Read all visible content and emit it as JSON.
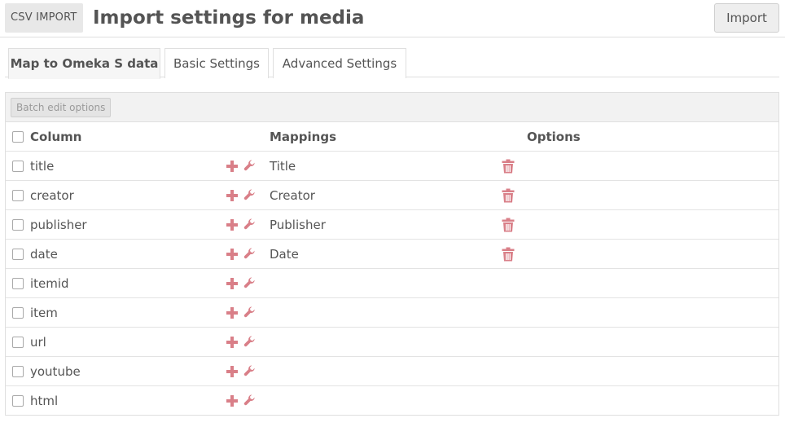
{
  "header": {
    "module_label": "CSV IMPORT",
    "title": "Import settings for media",
    "import_label": "Import"
  },
  "tabs": [
    {
      "label": "Map to Omeka S data",
      "active": true
    },
    {
      "label": "Basic Settings",
      "active": false
    },
    {
      "label": "Advanced Settings",
      "active": false
    }
  ],
  "batch": {
    "label": "Batch edit options"
  },
  "table": {
    "headers": {
      "column": "Column",
      "mappings": "Mappings",
      "options": "Options"
    },
    "rows": [
      {
        "column": "title",
        "mapping": "Title"
      },
      {
        "column": "creator",
        "mapping": "Creator"
      },
      {
        "column": "publisher",
        "mapping": "Publisher"
      },
      {
        "column": "date",
        "mapping": "Date"
      },
      {
        "column": "itemid",
        "mapping": ""
      },
      {
        "column": "item",
        "mapping": ""
      },
      {
        "column": "url",
        "mapping": ""
      },
      {
        "column": "youtube",
        "mapping": ""
      },
      {
        "column": "html",
        "mapping": ""
      }
    ]
  },
  "icons": {
    "add": "plus-icon",
    "configure": "wrench-icon",
    "remove": "trash-icon"
  },
  "colors": {
    "accent": "#d97f88",
    "border": "#dfdfdf",
    "text": "#555555"
  }
}
